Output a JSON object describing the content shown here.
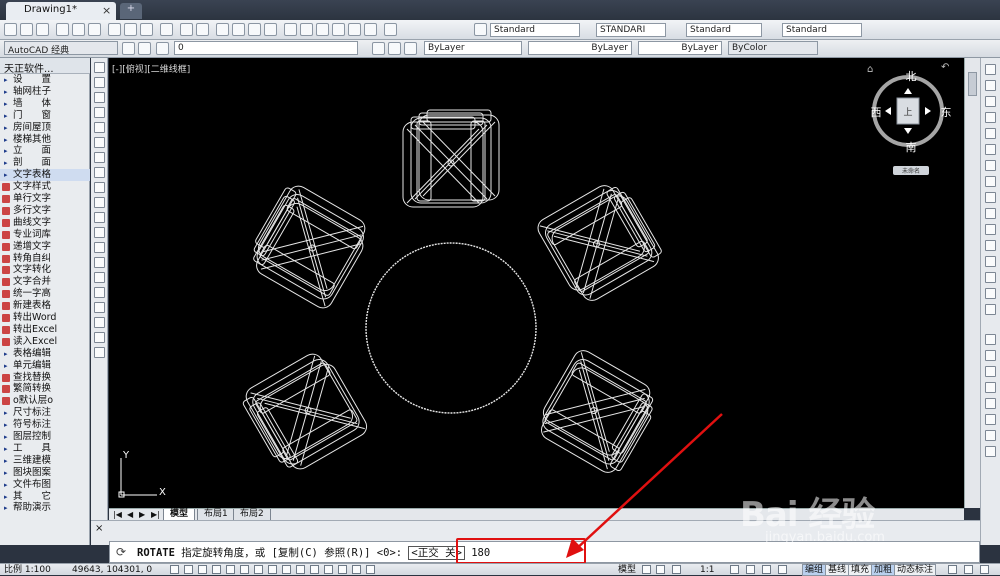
{
  "title": {
    "tab": "Drawing1*",
    "close": "×",
    "new_tab": "+"
  },
  "toolbar1": {
    "text_style": "Standard",
    "dim_style": "STANDARI",
    "table_style": "Standard",
    "mleader_style": "Standard"
  },
  "toolbar2": {
    "workspace": "AutoCAD 经典",
    "layer": "0",
    "color": "ByLayer",
    "linetype": "ByLayer",
    "lineweight": "ByLayer",
    "plotstyle": "ByColor"
  },
  "left_panel": {
    "title": "天正软件...",
    "items": [
      {
        "label": "设　　置",
        "type": "menu"
      },
      {
        "label": "轴网柱子",
        "type": "menu"
      },
      {
        "label": "墙　　体",
        "type": "menu"
      },
      {
        "label": "门　　窗",
        "type": "menu"
      },
      {
        "label": "房间屋顶",
        "type": "menu"
      },
      {
        "label": "楼梯其他",
        "type": "menu"
      },
      {
        "label": "立　　面",
        "type": "menu"
      },
      {
        "label": "剖　　面",
        "type": "menu"
      },
      {
        "label": "文字表格",
        "type": "menu",
        "selected": true
      },
      {
        "label": "文字样式",
        "type": "tool"
      },
      {
        "label": "单行文字",
        "type": "tool"
      },
      {
        "label": "多行文字",
        "type": "tool"
      },
      {
        "label": "曲线文字",
        "type": "tool"
      },
      {
        "label": "专业词库",
        "type": "tool"
      },
      {
        "label": "递增文字",
        "type": "tool"
      },
      {
        "label": "转角自纠",
        "type": "tool"
      },
      {
        "label": "文字转化",
        "type": "tool"
      },
      {
        "label": "文字合并",
        "type": "tool"
      },
      {
        "label": "统一字高",
        "type": "tool"
      },
      {
        "label": "新建表格",
        "type": "tool"
      },
      {
        "label": "转出Word",
        "type": "tool"
      },
      {
        "label": "转出Excel",
        "type": "tool"
      },
      {
        "label": "读入Excel",
        "type": "tool"
      },
      {
        "label": "表格编辑",
        "type": "menu"
      },
      {
        "label": "单元编辑",
        "type": "menu"
      },
      {
        "label": "查找替换",
        "type": "tool"
      },
      {
        "label": "繁简转换",
        "type": "tool"
      },
      {
        "label": "o默认层o",
        "type": "tool"
      },
      {
        "label": "尺寸标注",
        "type": "menu"
      },
      {
        "label": "符号标注",
        "type": "menu"
      },
      {
        "label": "图层控制",
        "type": "menu"
      },
      {
        "label": "工　　具",
        "type": "menu"
      },
      {
        "label": "三维建模",
        "type": "menu"
      },
      {
        "label": "图块图案",
        "type": "menu"
      },
      {
        "label": "文件布图",
        "type": "menu"
      },
      {
        "label": "其　　它",
        "type": "menu"
      },
      {
        "label": "帮助演示",
        "type": "menu"
      }
    ]
  },
  "viewport": {
    "label": "[-][俯视][二维线框]"
  },
  "viewcube": {
    "north": "北",
    "south": "南",
    "east": "东",
    "west": "西",
    "face": "上",
    "wcs": "未命名"
  },
  "ucs": {
    "x": "X",
    "y": "Y"
  },
  "layout_tabs": [
    "模型",
    "布局1",
    "布局2"
  ],
  "command": {
    "prefix": "ROTATE",
    "text": "指定旋转角度，或 [复制(C) 参照(R)] <0>:",
    "ortho": "<正交 关>",
    "value": "180"
  },
  "status": {
    "scale": "比例 1:100",
    "coords": "49643, 104301, 0",
    "model": "模型",
    "anno": "1:1",
    "buttons": [
      "编组",
      "基线",
      "填充",
      "加粗",
      "动态标注"
    ]
  },
  "watermark": {
    "brand": "Bai 经验",
    "url": "jingyan.baidu.com"
  },
  "colors": {
    "canvas": "#000000",
    "accent": "#e01010",
    "drawing": "#e6e6e6"
  }
}
